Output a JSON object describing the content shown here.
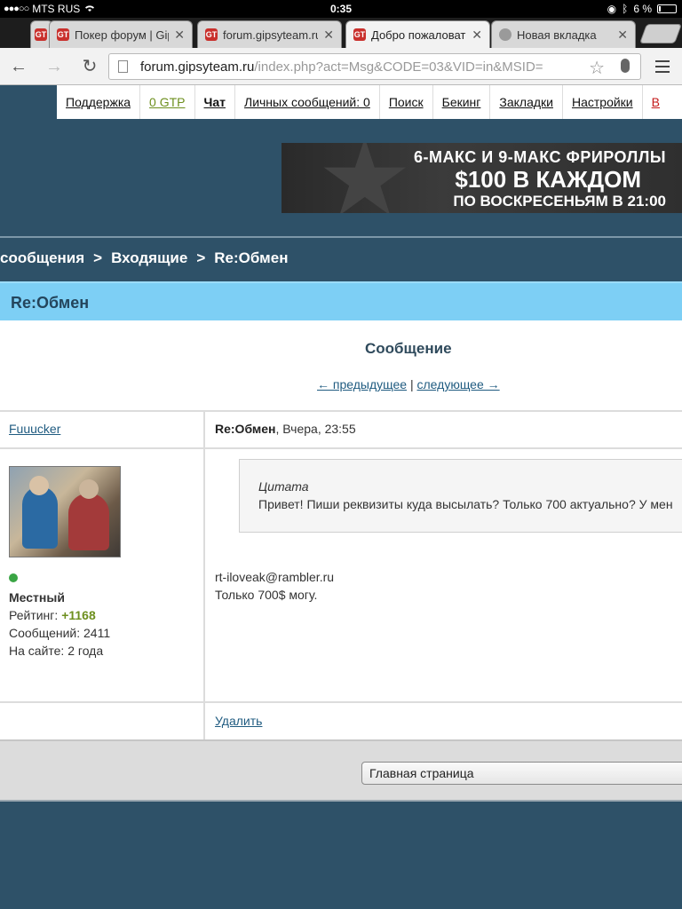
{
  "status_bar": {
    "signal": "●●●○○",
    "carrier": "MTS RUS",
    "time": "0:35",
    "battery": "6 %"
  },
  "browser": {
    "tabs": [
      {
        "label": "",
        "favicon": "poker-favicon"
      },
      {
        "label": "Покер форум | Gips",
        "favicon": "poker-favicon"
      },
      {
        "label": "forum.gipsyteam.ru/i",
        "favicon": "poker-favicon"
      },
      {
        "label": "Добро пожаловать",
        "favicon": "poker-favicon",
        "active": true
      },
      {
        "label": "Новая вкладка",
        "favicon": "globe-icon"
      }
    ],
    "url_host": "forum.gipsyteam.ru",
    "url_path": "/index.php?act=Msg&CODE=03&VID=in&MSID="
  },
  "site_nav": {
    "items": [
      "Поддержка",
      "0 GTP",
      "Чат",
      "Личных сообщений: 0",
      "Поиск",
      "Бекинг",
      "Закладки",
      "Настройки",
      "В"
    ]
  },
  "banner": {
    "line1": "6-МАКС И 9-МАКС ФРИРОЛЛЫ",
    "line2": "$100 В КАЖДОМ",
    "line3": "ПО ВОСКРЕСЕНЬЯМ В 21:00"
  },
  "breadcrumb": {
    "items": [
      "сообщения",
      "Входящие",
      "Re:Обмен"
    ],
    "separator": ">"
  },
  "subject": "Re:Обмен",
  "message_view": {
    "heading": "Сообщение",
    "prev_label": "← предыдущее",
    "divider": "|",
    "next_label": "следующее →"
  },
  "post": {
    "author": "Fuuucker",
    "title": "Re:Обмен",
    "date": ", Вчера, 23:55",
    "user_rank": "Местный",
    "rating_label": "Рейтинг: ",
    "rating_value": "+1168",
    "posts_label": "Сообщений: 2411",
    "site_age": "На сайте: 2 года",
    "quote_label": "Цитата",
    "quote_text": "Привет! Пиши реквизиты куда высылать? Только 700 актуально? У мен",
    "body_line1": "rt-iloveak@rambler.ru",
    "body_line2": "Только 700$ могу.",
    "delete_label": "Удалить"
  },
  "footer": {
    "jump_select": "Главная страница"
  },
  "colors": {
    "page_bg": "#2e5168",
    "subject_bar": "#7dcff5",
    "link": "#1f5b80",
    "rating": "#6d8f1e"
  }
}
